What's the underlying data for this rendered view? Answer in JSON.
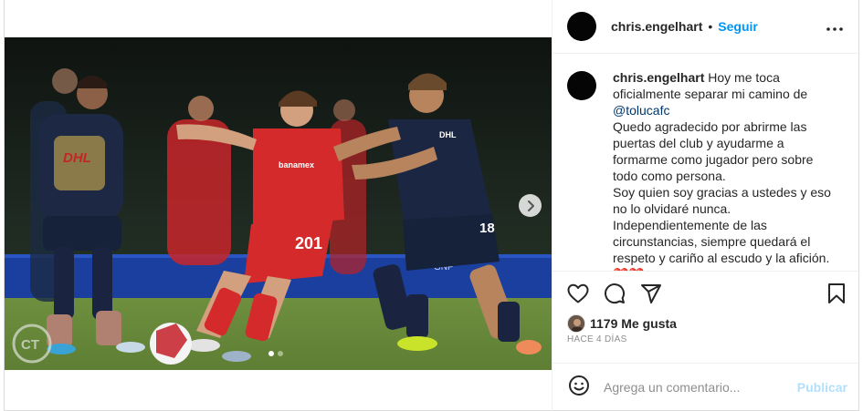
{
  "post": {
    "username": "chris.engelhart",
    "separator": "•",
    "follow_label": "Seguir",
    "more_icon": "more-horizontal-icon",
    "caption": {
      "username": "chris.engelhart",
      "line1": "Hoy me toca oficialmente separar mi camino de",
      "mention": "@tolucafc",
      "paragraph2": "Quedo agradecido por abrirme las puertas del club y ayudarme a formarme como jugador pero sobre todo como persona.",
      "paragraph3": "Soy quien soy gracias a ustedes y eso no lo olvidaré nunca.",
      "paragraph4": "Independientemente de las circunstancias, siempre quedará el respeto y cariño al escudo y la afición.",
      "paragraph5": "❤️❤️"
    },
    "media": {
      "carousel_total": 2,
      "carousel_index": 1,
      "next_icon": "chevron-right-icon",
      "jersey_number_red": "201",
      "jersey_number_blue": "18",
      "sponsor_red": "banamex",
      "sponsor_blue": "DHL",
      "watermark": "CT",
      "ad_board": "GNP"
    },
    "actions": {
      "like_icon": "heart-icon",
      "comment_icon": "comment-icon",
      "share_icon": "send-icon",
      "save_icon": "bookmark-icon"
    },
    "likes_text": "1179 Me gusta",
    "time_ago": "HACE 4 DÍAS",
    "comment_placeholder": "Agrega un comentario...",
    "publish_label": "Publicar",
    "emoji_icon": "smiley-icon"
  },
  "colors": {
    "accent_blue": "#0095f6",
    "publish_disabled": "#b2dffc",
    "mention": "#00376b",
    "secondary_text": "#8e8e8e",
    "border": "#dbdbdb"
  }
}
